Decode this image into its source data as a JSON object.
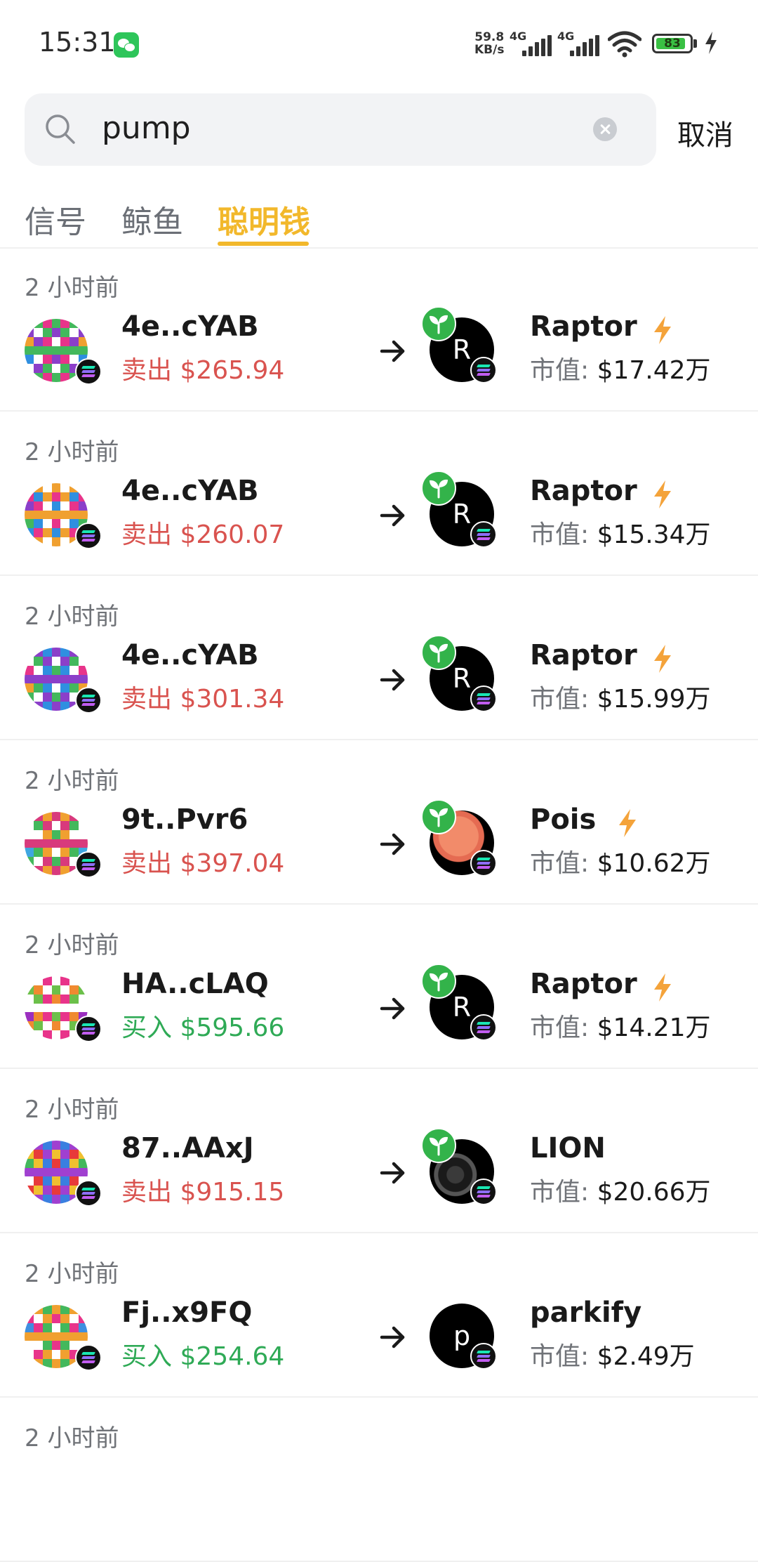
{
  "status_bar": {
    "time": "15:31",
    "net_speed_value": "59.8",
    "net_speed_unit": "KB/s",
    "network_1": "4G",
    "network_2": "4G",
    "battery": "83",
    "icons": [
      "wechat-icon",
      "signal-icon",
      "wifi-icon",
      "battery-icon",
      "charging-icon"
    ]
  },
  "search": {
    "value": "pump",
    "cancel_label": "取消"
  },
  "tabs": [
    {
      "label": "信号",
      "active": false
    },
    {
      "label": "鲸鱼",
      "active": false
    },
    {
      "label": "聪明钱",
      "active": true
    }
  ],
  "colors": {
    "accent": "#f2b82b",
    "sell": "#d9534f",
    "buy": "#2faa56",
    "bolt": "#f4a33a",
    "sprout_badge": "#33b34a"
  },
  "mcap_label": "市值:",
  "rows": [
    {
      "time": "2 小时前",
      "wallet": "4e..cYAB",
      "side": "卖出",
      "amount": "$265.94",
      "type": "sell",
      "token": "Raptor",
      "token_initial": "R",
      "bolt": true,
      "sprout": true,
      "mcap": "$17.42万"
    },
    {
      "time": "2 小时前",
      "wallet": "4e..cYAB",
      "side": "卖出",
      "amount": "$260.07",
      "type": "sell",
      "token": "Raptor",
      "token_initial": "R",
      "bolt": true,
      "sprout": true,
      "mcap": "$15.34万"
    },
    {
      "time": "2 小时前",
      "wallet": "4e..cYAB",
      "side": "卖出",
      "amount": "$301.34",
      "type": "sell",
      "token": "Raptor",
      "token_initial": "R",
      "bolt": true,
      "sprout": true,
      "mcap": "$15.99万"
    },
    {
      "time": "2 小时前",
      "wallet": "9t..Pvr6",
      "side": "卖出",
      "amount": "$397.04",
      "type": "sell",
      "token": "Pois",
      "token_initial": "",
      "bolt": true,
      "sprout": true,
      "mcap": "$10.62万"
    },
    {
      "time": "2 小时前",
      "wallet": "HA..cLAQ",
      "side": "买入",
      "amount": "$595.66",
      "type": "buy",
      "token": "Raptor",
      "token_initial": "R",
      "bolt": true,
      "sprout": true,
      "mcap": "$14.21万"
    },
    {
      "time": "2 小时前",
      "wallet": "87..AAxJ",
      "side": "卖出",
      "amount": "$915.15",
      "type": "sell",
      "token": "LION",
      "token_initial": "",
      "bolt": false,
      "sprout": true,
      "mcap": "$20.66万"
    },
    {
      "time": "2 小时前",
      "wallet": "Fj..x9FQ",
      "side": "买入",
      "amount": "$254.64",
      "type": "buy",
      "token": "parkify",
      "token_initial": "p",
      "bolt": false,
      "sprout": false,
      "mcap": "$2.49万"
    },
    {
      "time": "2 小时前"
    }
  ]
}
